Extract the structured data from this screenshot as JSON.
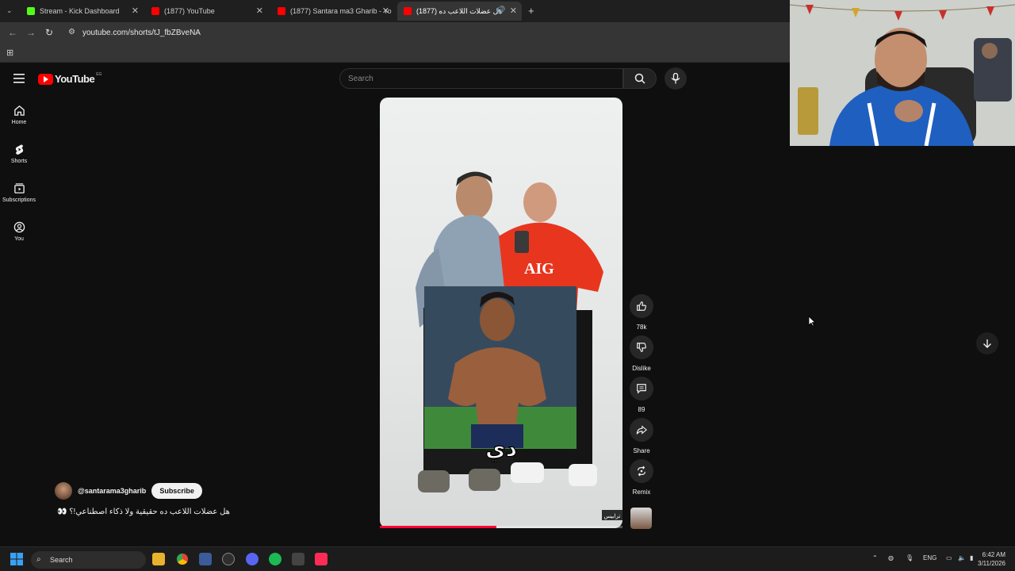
{
  "browser": {
    "tabs": [
      {
        "title": "Stream - Kick Dashboard",
        "favicon_color": "#53fc18",
        "active": false
      },
      {
        "title": "(1877) YouTube",
        "favicon_color": "#ff0000",
        "active": false
      },
      {
        "title": "(1877) Santara ma3 Gharib - Yo",
        "favicon_color": "#ff0000",
        "active": false
      },
      {
        "title": "(1877) هل عضلات اللاعب ده",
        "favicon_color": "#ff0000",
        "active": true
      }
    ],
    "new_tab_symbol": "+",
    "url": "youtube.com/shorts/tJ_fbZBveNA"
  },
  "youtube": {
    "logo_text": "YouTube",
    "region": "EG",
    "search_placeholder": "Search",
    "sidebar": [
      {
        "label": "Home",
        "icon": "home-icon"
      },
      {
        "label": "Shorts",
        "icon": "shorts-icon"
      },
      {
        "label": "Subscriptions",
        "icon": "subscriptions-icon"
      },
      {
        "label": "You",
        "icon": "you-icon"
      }
    ],
    "actions": {
      "like_count": "78k",
      "dislike_label": "Dislike",
      "comment_count": "89",
      "share_label": "Share",
      "remix_label": "Remix"
    },
    "channel": {
      "handle": "@santarama3gharib",
      "subscribe_label": "Subscribe"
    },
    "video_title": "هل عضلات اللاعب ده حقيقية ولا ذكاء اصطناعي!؟ 👀",
    "overlay": {
      "caption": "دي",
      "jersey_text": "AIG",
      "watermark": "ترابيس"
    },
    "progress": 0.48
  },
  "taskbar": {
    "search_label": "Search",
    "language": "ENG",
    "time": "6:42 AM",
    "date": "3/11/2026"
  },
  "colors": {
    "yt_red": "#ff0000",
    "background": "#0f0f0f",
    "progress": "#ff0033"
  }
}
